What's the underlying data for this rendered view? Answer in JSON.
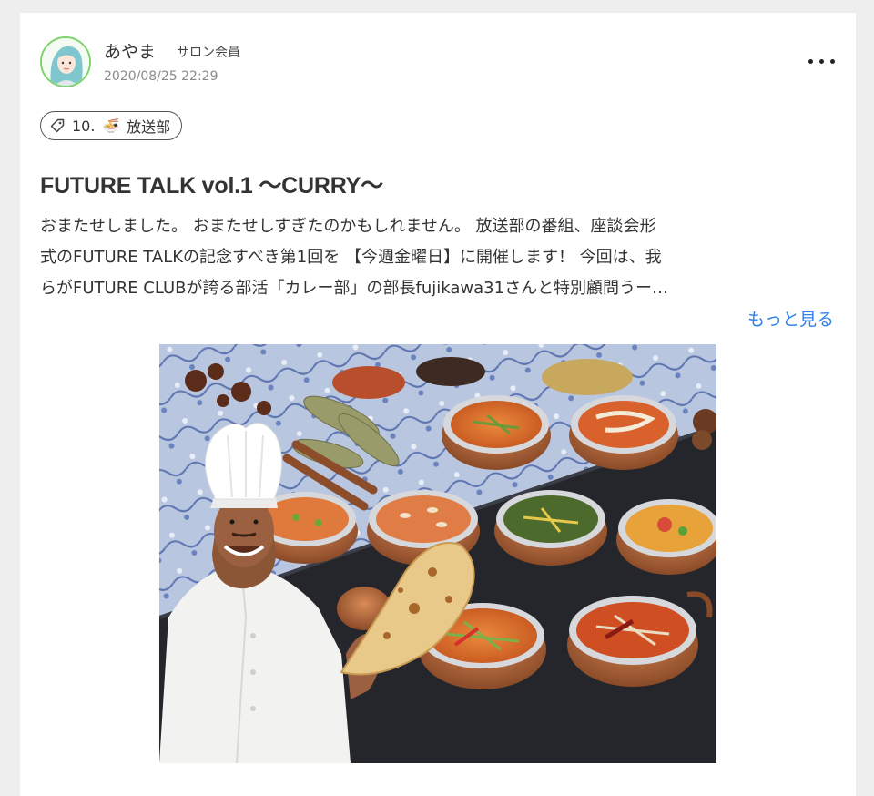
{
  "post": {
    "author": {
      "name": "あやま",
      "role": "サロン会員",
      "avatar_icon": "user-avatar-illustration"
    },
    "date": "2020/08/25 22:29",
    "menu_icon": "more-dots-icon",
    "tag": {
      "icon": "tag-icon",
      "prefix": "10.",
      "emoji": "🍜",
      "label": "放送部"
    },
    "title": "FUTURE TALK vol.1 〜CURRY〜",
    "body_lines": [
      "おまたせしました。 おまたせしすぎたのかもしれません。 放送部の番組、座談会形",
      "式のFUTURE TALKの記念すべき第1回を 【今週金曜日】に開催します！ 今回は、我",
      "らがFUTURE CLUBが誇る部活「カレー部」の部長fujikawa31さんと特別顧問うー…"
    ],
    "see_more": "もっと見る"
  },
  "colors": {
    "link": "#2f80ed",
    "avatar_ring": "#7cd36a",
    "card_bg": "#ffffff",
    "page_bg": "#eeeeee"
  }
}
